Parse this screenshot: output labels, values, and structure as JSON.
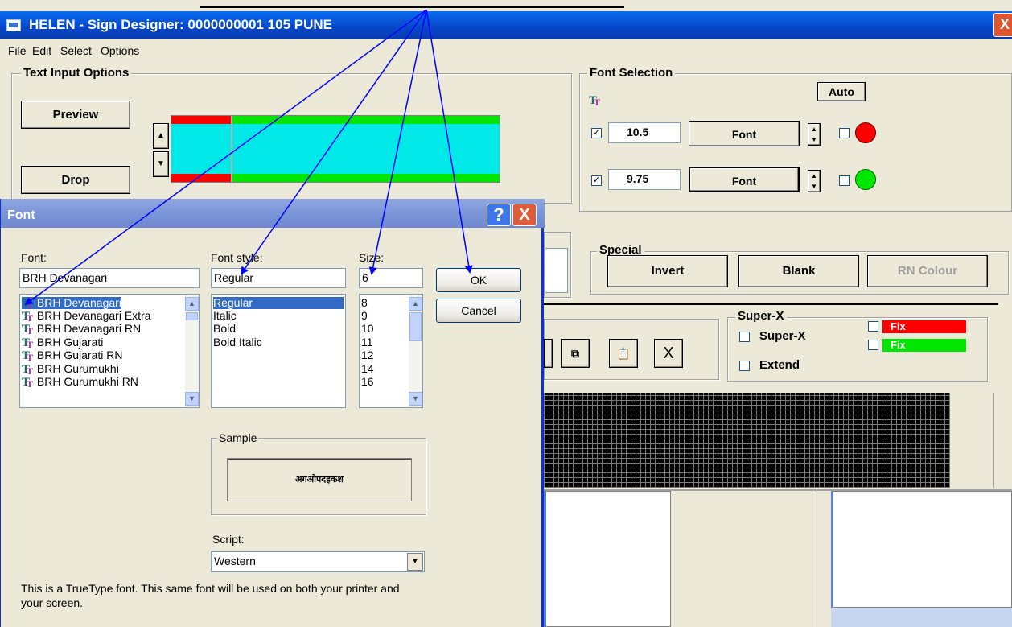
{
  "window": {
    "title": "HELEN - Sign Designer: 0000000001 105 PUNE",
    "close": "X"
  },
  "menu": [
    "File",
    "Edit",
    "Select",
    "Options"
  ],
  "text_input": {
    "title": "Text Input Options",
    "preview": "Preview",
    "drop": "Drop"
  },
  "font_selection": {
    "title": "Font Selection",
    "auto": "Auto",
    "rows": [
      {
        "checked": true,
        "size": "10.5",
        "button": "Font",
        "color": "#ff0000"
      },
      {
        "checked": true,
        "size": "9.75",
        "button": "Font",
        "color": "#00d000"
      }
    ]
  },
  "special": {
    "title": "Special",
    "invert": "Invert",
    "blank": "Blank",
    "rn_colour": "RN Colour"
  },
  "superx": {
    "title": "Super-X",
    "superx_label": "Super-X",
    "extend_label": "Extend",
    "fix_red": "Fix",
    "fix_green": "Fix"
  },
  "toolbar": {
    "copy": "copy",
    "paste": "paste",
    "delete": "X"
  },
  "dialog": {
    "title": "Font",
    "help": "?",
    "close": "X",
    "font_label": "Font:",
    "font_value": "BRH Devanagari",
    "fonts": [
      "BRH Devanagari",
      "BRH Devanagari Extra",
      "BRH Devanagari RN",
      "BRH Gujarati",
      "BRH Gujarati RN",
      "BRH Gurumukhi",
      "BRH Gurumukhi RN"
    ],
    "style_label": "Font style:",
    "style_value": "Regular",
    "styles": [
      "Regular",
      "Italic",
      "Bold",
      "Bold Italic"
    ],
    "size_label": "Size:",
    "size_value": "6",
    "sizes": [
      "8",
      "9",
      "10",
      "11",
      "12",
      "14",
      "16"
    ],
    "ok": "OK",
    "cancel": "Cancel",
    "sample_label": "Sample",
    "sample_text": "अगओपदहकश",
    "script_label": "Script:",
    "script_value": "Western",
    "info": "This is a TrueType font. This same font will be used on both your printer and your screen."
  },
  "colors": {
    "accent": "#316ac5",
    "title_blue": "#0a55e0",
    "arrow": "#0000ff",
    "cyan": "#00e8e8",
    "red": "#ff0000",
    "green": "#00e600"
  }
}
